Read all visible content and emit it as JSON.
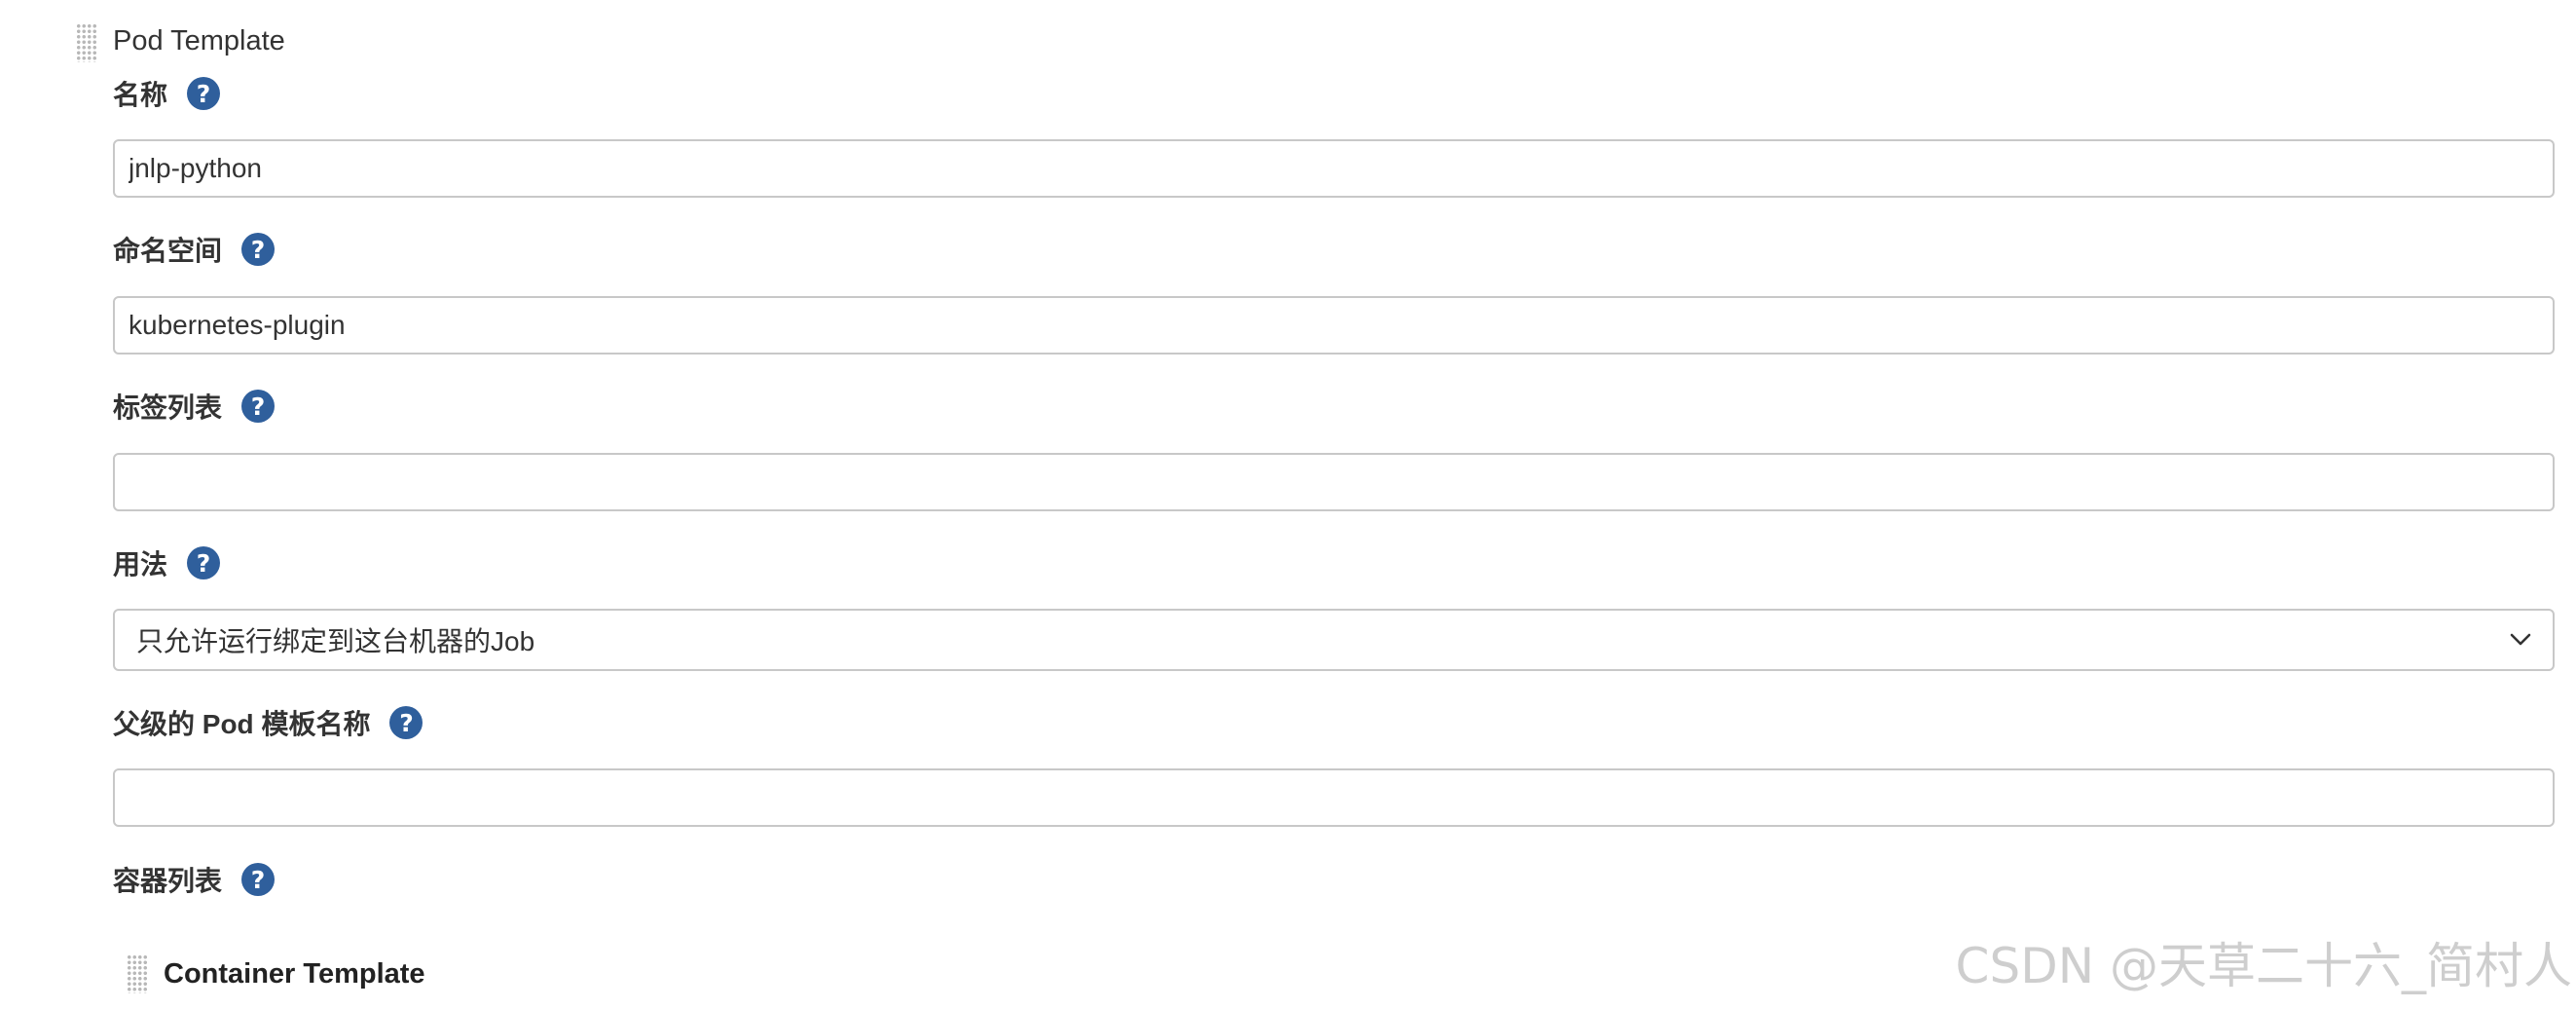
{
  "pod_template": {
    "title": "Pod Template",
    "fields": {
      "name": {
        "label": "名称",
        "value": "jnlp-python"
      },
      "namespace": {
        "label": "命名空间",
        "value": "kubernetes-plugin"
      },
      "labels": {
        "label": "标签列表",
        "value": ""
      },
      "usage": {
        "label": "用法",
        "selected": "只允许运行绑定到这台机器的Job"
      },
      "parent_template": {
        "label": "父级的 Pod 模板名称",
        "value": ""
      },
      "containers": {
        "label": "容器列表"
      }
    },
    "help_icon_glyph": "?",
    "help_icon_color": "#2f5f9c"
  },
  "container_template": {
    "title": "Container Template"
  },
  "watermark": {
    "text": "CSDN @天草二十六_简村人"
  },
  "icons": [
    "drag-handle-icon",
    "help-icon",
    "chevron-down-icon"
  ]
}
